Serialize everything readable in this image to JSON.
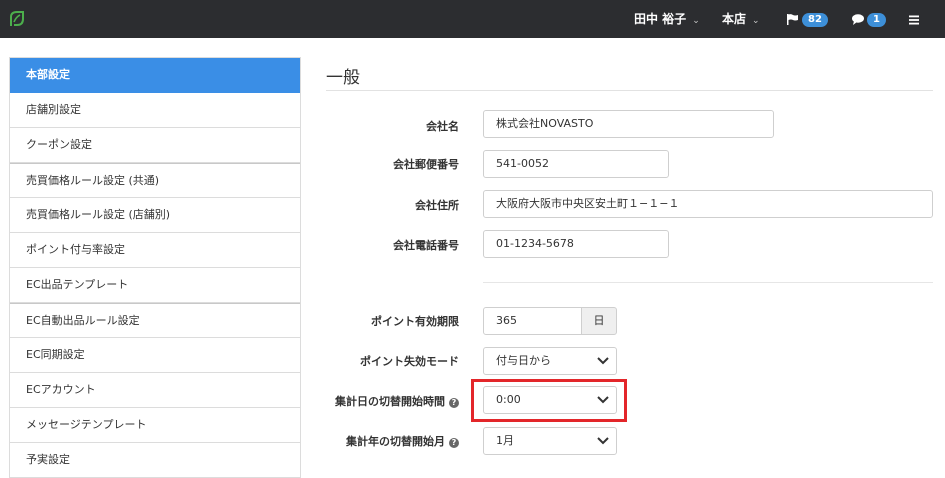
{
  "topbar": {
    "user_name": "田中 裕子",
    "store": "本店",
    "flag_count": "82",
    "message_count": "1"
  },
  "sidebar": {
    "items": [
      {
        "label": "本部設定"
      },
      {
        "label": "店舗別設定"
      },
      {
        "label": "クーポン設定"
      },
      {
        "label": "売買価格ルール設定 (共通)"
      },
      {
        "label": "売買価格ルール設定 (店舗別)"
      },
      {
        "label": "ポイント付与率設定"
      },
      {
        "label": "EC出品テンプレート"
      },
      {
        "label": "EC自動出品ルール設定"
      },
      {
        "label": "EC同期設定"
      },
      {
        "label": "ECアカウント"
      },
      {
        "label": "メッセージテンプレート"
      },
      {
        "label": "予実設定"
      }
    ]
  },
  "main": {
    "heading": "一般",
    "fields": {
      "company_name": {
        "label": "会社名",
        "value": "株式会社NOVASTO"
      },
      "postal_code": {
        "label": "会社郵便番号",
        "value": "541-0052"
      },
      "address": {
        "label": "会社住所",
        "value": "大阪府大阪市中央区安土町１−１−１"
      },
      "phone": {
        "label": "会社電話番号",
        "value": "01-1234-5678"
      },
      "point_expiry": {
        "label": "ポイント有効期限",
        "value": "365",
        "unit": "日"
      },
      "point_expiry_mode": {
        "label": "ポイント失効モード",
        "value": "付与日から"
      },
      "daily_switch_time": {
        "label": "集計日の切替開始時間",
        "value": "0:00"
      },
      "yearly_switch_month": {
        "label": "集計年の切替開始月",
        "value": "1月"
      }
    }
  },
  "colors": {
    "topbar": "#2c2d30",
    "accent": "#3a8ee6",
    "highlight": "#e3262a"
  }
}
